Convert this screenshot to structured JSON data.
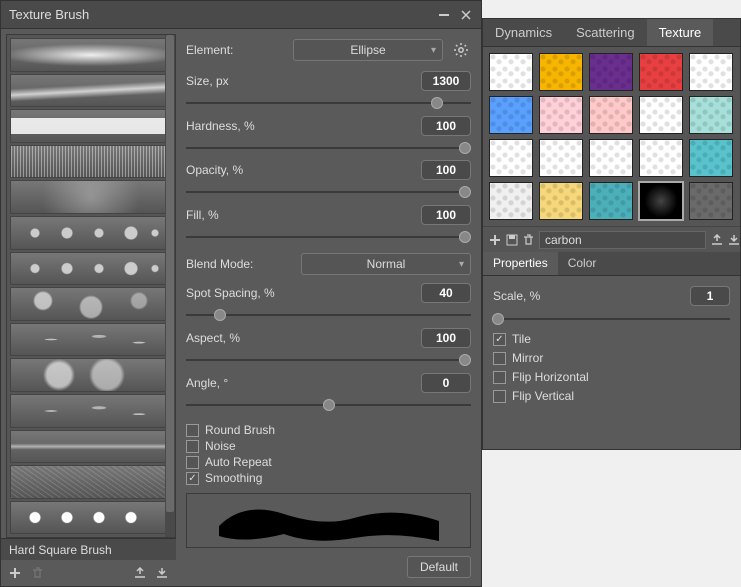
{
  "left_panel": {
    "title": "Texture Brush",
    "brush_name": "Hard Square Brush",
    "settings": {
      "element_label": "Element:",
      "element_value": "Ellipse",
      "size_label": "Size, px",
      "size_value": "1300",
      "hardness_label": "Hardness, %",
      "hardness_value": "100",
      "opacity_label": "Opacity, %",
      "opacity_value": "100",
      "fill_label": "Fill, %",
      "fill_value": "100",
      "blend_label": "Blend Mode:",
      "blend_value": "Normal",
      "spacing_label": "Spot Spacing, %",
      "spacing_value": "40",
      "aspect_label": "Aspect, %",
      "aspect_value": "100",
      "angle_label": "Angle, °",
      "angle_value": "0",
      "round_brush_label": "Round Brush",
      "noise_label": "Noise",
      "auto_repeat_label": "Auto Repeat",
      "smoothing_label": "Smoothing",
      "round_brush_checked": false,
      "noise_checked": false,
      "auto_repeat_checked": false,
      "smoothing_checked": true,
      "default_button": "Default"
    }
  },
  "right_panel": {
    "tabs": {
      "dynamics": "Dynamics",
      "scattering": "Scattering",
      "texture": "Texture"
    },
    "active_tab": "texture",
    "texture_colors": [
      "#fff",
      "#f7b500",
      "#6a2e8f",
      "#e84040",
      "#fff",
      "#5aa0ff",
      "#ffd0d8",
      "#ffc9c9",
      "#fff",
      "#a7e0da",
      "#fff",
      "#fff",
      "#fff",
      "#fff",
      "#58c3cc",
      "#f0f0f0",
      "#f6d77a",
      "#4bb0ba",
      "#111",
      "#6a6a6a"
    ],
    "selected_texture_index": 18,
    "texture_name": "carbon",
    "sub_tabs": {
      "properties": "Properties",
      "color": "Color"
    },
    "active_sub_tab": "properties",
    "properties": {
      "scale_label": "Scale, %",
      "scale_value": "1",
      "tile_label": "Tile",
      "mirror_label": "Mirror",
      "flip_h_label": "Flip Horizontal",
      "flip_v_label": "Flip Vertical",
      "tile_checked": true,
      "mirror_checked": false,
      "flip_h_checked": false,
      "flip_v_checked": false
    }
  }
}
